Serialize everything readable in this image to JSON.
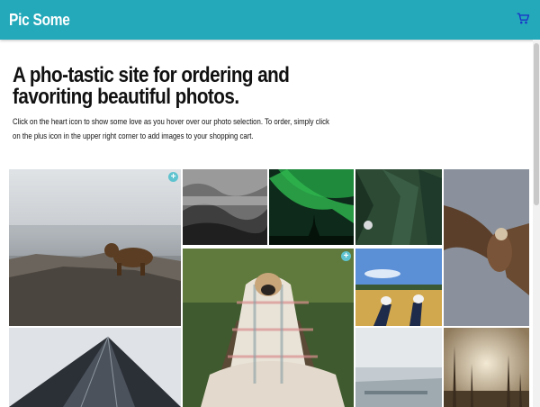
{
  "header": {
    "brand": "Pic Some",
    "cart_icon": "shopping-cart-icon",
    "background": "#24a9ba",
    "cart_color": "#1a35c8"
  },
  "hero": {
    "title": "A pho-tastic site for ordering and favoriting beautiful photos.",
    "description": "Click on the heart icon to show some love as you hover over our photo selection. To order, simply click on the plus icon in the upper right corner to add images to your shopping cart."
  },
  "gallery": {
    "photos": [
      {
        "subject": "bear on rocks",
        "add_icon": "plus-icon"
      },
      {
        "subject": "foggy forest mountains"
      },
      {
        "subject": "northern lights over trees"
      },
      {
        "subject": "forest from above"
      },
      {
        "subject": "eagle in flight"
      },
      {
        "subject": "pug wrapped in plaid blanket",
        "add_icon": "plus-icon"
      },
      {
        "subject": "feet over wheat field"
      },
      {
        "subject": "skyscraper from below"
      },
      {
        "subject": "hazy city landscape"
      },
      {
        "subject": "bare trees in sunlight"
      }
    ]
  }
}
